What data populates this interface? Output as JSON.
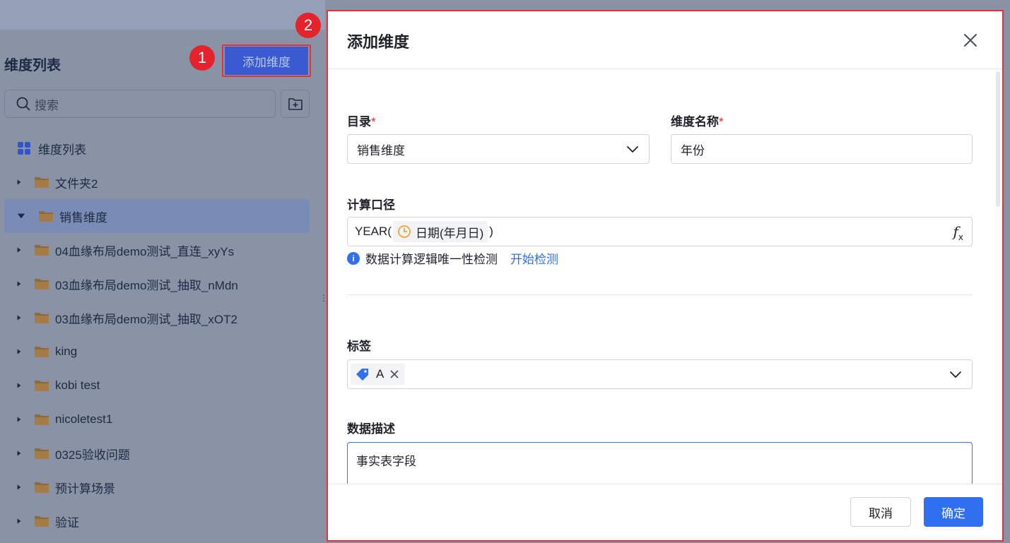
{
  "left": {
    "title": "维度列表",
    "add_button": "添加维度",
    "search_placeholder": "搜索",
    "tree": {
      "root": "维度列表",
      "items": [
        {
          "label": "文件夹2",
          "expanded": false,
          "selected": false
        },
        {
          "label": "销售维度",
          "expanded": true,
          "selected": true
        },
        {
          "label": "04血缘布局demo测试_直连_xyYs",
          "expanded": false,
          "selected": false
        },
        {
          "label": "03血缘布局demo测试_抽取_nMdn",
          "expanded": false,
          "selected": false
        },
        {
          "label": "03血缘布局demo测试_抽取_xOT2",
          "expanded": false,
          "selected": false
        },
        {
          "label": "king",
          "expanded": false,
          "selected": false
        },
        {
          "label": "kobi test",
          "expanded": false,
          "selected": false
        },
        {
          "label": "nicoletest1",
          "expanded": false,
          "selected": false
        },
        {
          "label": "0325验收问题",
          "expanded": false,
          "selected": false
        },
        {
          "label": "预计算场景",
          "expanded": false,
          "selected": false
        },
        {
          "label": "验证",
          "expanded": false,
          "selected": false
        }
      ]
    }
  },
  "annotations": {
    "badge1": "1",
    "badge2": "2"
  },
  "modal": {
    "title": "添加维度",
    "catalog_label": "目录",
    "catalog_value": "销售维度",
    "name_label": "维度名称",
    "name_value": "年份",
    "required_mark": "*",
    "formula_label": "计算口径",
    "formula_prefix": "YEAR(",
    "formula_field": "日期(年月日)",
    "formula_suffix": ")",
    "formula_icon": "fx",
    "check_text": "数据计算逻辑唯一性检测",
    "check_link": "开始检测",
    "tag_label": "标签",
    "tag_value": "A",
    "desc_label": "数据描述",
    "desc_value": "事实表字段",
    "cancel_button": "取消",
    "ok_button": "确定"
  },
  "colors": {
    "primary": "#2f6ff0",
    "required": "#e5232d",
    "annotation": "#e2323a",
    "overlay": "#8a93a6"
  }
}
